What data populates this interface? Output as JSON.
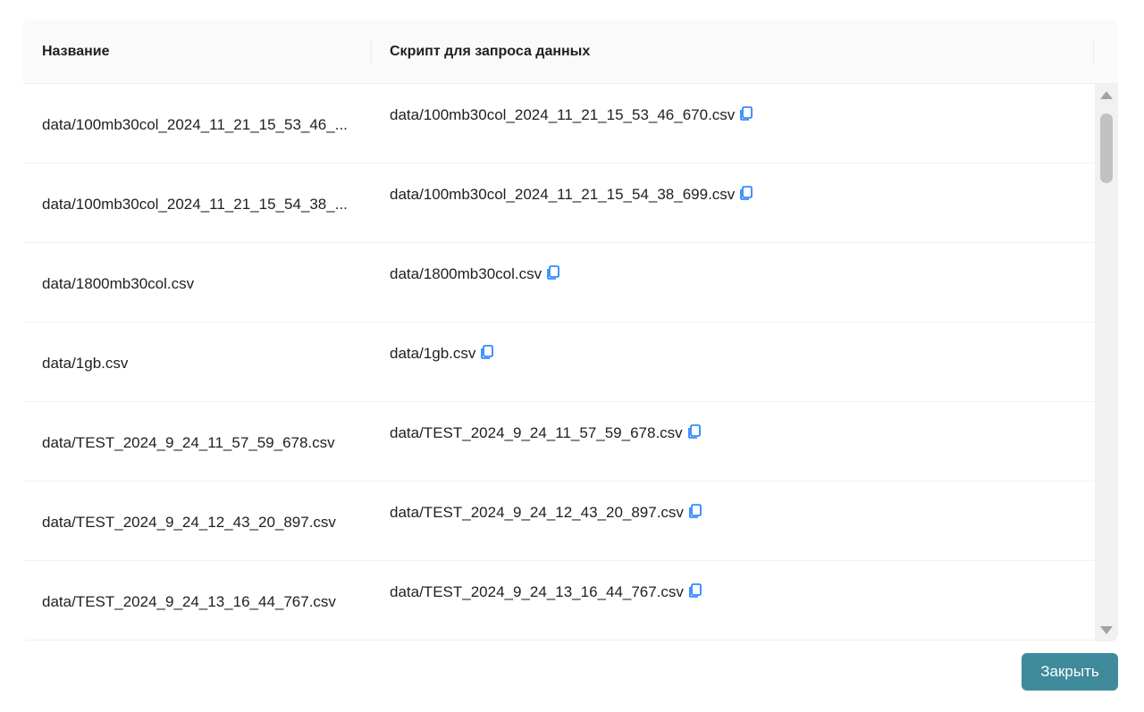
{
  "table": {
    "columns": {
      "name": "Название",
      "script": "Скрипт для запроса данных"
    },
    "rows": [
      {
        "name": "data/100mb30col_2024_11_21_15_53_46_...",
        "script": "data/100mb30col_2024_11_21_15_53_46_670.csv"
      },
      {
        "name": "data/100mb30col_2024_11_21_15_54_38_...",
        "script": "data/100mb30col_2024_11_21_15_54_38_699.csv"
      },
      {
        "name": "data/1800mb30col.csv",
        "script": "data/1800mb30col.csv"
      },
      {
        "name": "data/1gb.csv",
        "script": "data/1gb.csv"
      },
      {
        "name": "data/TEST_2024_9_24_11_57_59_678.csv",
        "script": "data/TEST_2024_9_24_11_57_59_678.csv"
      },
      {
        "name": "data/TEST_2024_9_24_12_43_20_897.csv",
        "script": "data/TEST_2024_9_24_12_43_20_897.csv"
      },
      {
        "name": "data/TEST_2024_9_24_13_16_44_767.csv",
        "script": "data/TEST_2024_9_24_13_16_44_767.csv"
      }
    ],
    "copy_icon": "copy-icon",
    "copy_icon_color": "#1677ff"
  },
  "footer": {
    "close_label": "Закрыть",
    "close_color": "#3f8a9b"
  }
}
